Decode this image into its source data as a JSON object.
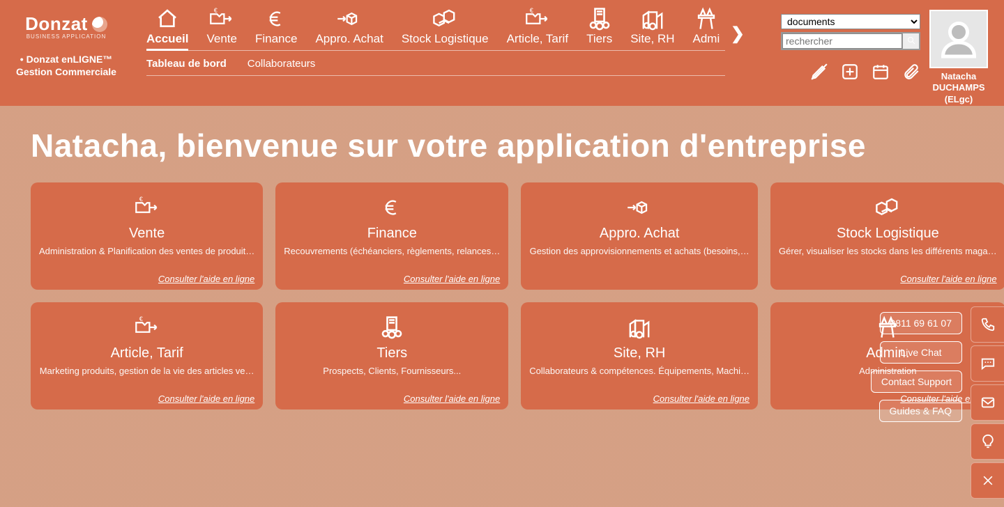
{
  "brand": {
    "name": "Donzat",
    "tagline": "BUSINESS APPLICATION",
    "desc_line1": "Donzat enLIGNE™",
    "desc_line2": "Gestion Commerciale"
  },
  "nav": {
    "items": [
      {
        "label": "Accueil",
        "icon": "home",
        "active": true
      },
      {
        "label": "Vente",
        "icon": "sale",
        "active": false
      },
      {
        "label": "Finance",
        "icon": "euro",
        "active": false
      },
      {
        "label": "Appro. Achat",
        "icon": "supply",
        "active": false
      },
      {
        "label": "Stock Logistique",
        "icon": "stock",
        "active": false
      },
      {
        "label": "Article, Tarif",
        "icon": "article",
        "active": false
      },
      {
        "label": "Tiers",
        "icon": "tiers",
        "active": false
      },
      {
        "label": "Site, RH",
        "icon": "site",
        "active": false
      },
      {
        "label": "Admi",
        "icon": "admin",
        "active": false
      }
    ],
    "next_glyph": "❯"
  },
  "subnav": {
    "items": [
      {
        "label": "Tableau de bord",
        "active": true
      },
      {
        "label": "Collaborateurs",
        "active": false
      }
    ]
  },
  "search": {
    "select_value": "documents",
    "placeholder": "rechercher",
    "search_glyph": "🔍"
  },
  "toolbar_icons": {
    "pen": "✒",
    "plus": "⊞",
    "calendar": "📅",
    "clip": "📎"
  },
  "user": {
    "first": "Natacha",
    "last": "DUCHAMPS",
    "org": "(ELgc)"
  },
  "welcome": "Natacha, bienvenue sur votre application d'entreprise",
  "help_link": "Consulter l'aide en ligne",
  "cards": [
    {
      "title": "Vente",
      "desc": "Administration & Planification des ventes de produit…",
      "icon": "sale",
      "help": true,
      "locked": false
    },
    {
      "title": "Finance",
      "desc": "Recouvrements (échéanciers, règlements, relances…",
      "icon": "euro",
      "help": true,
      "locked": false
    },
    {
      "title": "Appro. Achat",
      "desc": "Gestion des approvisionnements et achats (besoins,…",
      "icon": "supply",
      "help": false,
      "locked": false
    },
    {
      "title": "Stock Logistique",
      "desc": "Gérer, visualiser les stocks dans les différents maga…",
      "icon": "stock",
      "help": true,
      "locked": false
    },
    {
      "title": "Article, Tarif",
      "desc": "Marketing produits, gestion de la vie des articles ve…",
      "icon": "article",
      "help": true,
      "locked": false
    },
    {
      "title": "Tiers",
      "desc": "Prospects, Clients, Fournisseurs...",
      "icon": "tiers",
      "help": true,
      "locked": false
    },
    {
      "title": "Site, RH",
      "desc": "Collaborateurs & compétences. Équipements, Machi…",
      "icon": "site",
      "help": true,
      "locked": false
    },
    {
      "title": "Admin.",
      "desc": "Administration",
      "icon": "admin",
      "help": true,
      "locked": true
    }
  ],
  "float_buttons": [
    {
      "label": "0811 69 61 07"
    },
    {
      "label": "Live Chat"
    },
    {
      "label": "Contact Support"
    },
    {
      "label": "Guides & FAQ"
    }
  ],
  "side_tabs": [
    {
      "name": "phone-icon",
      "glyph": "phone"
    },
    {
      "name": "chat-icon",
      "glyph": "chat"
    },
    {
      "name": "mail-icon",
      "glyph": "mail"
    },
    {
      "name": "idea-icon",
      "glyph": "bulb"
    },
    {
      "name": "close-icon",
      "glyph": "close"
    }
  ]
}
